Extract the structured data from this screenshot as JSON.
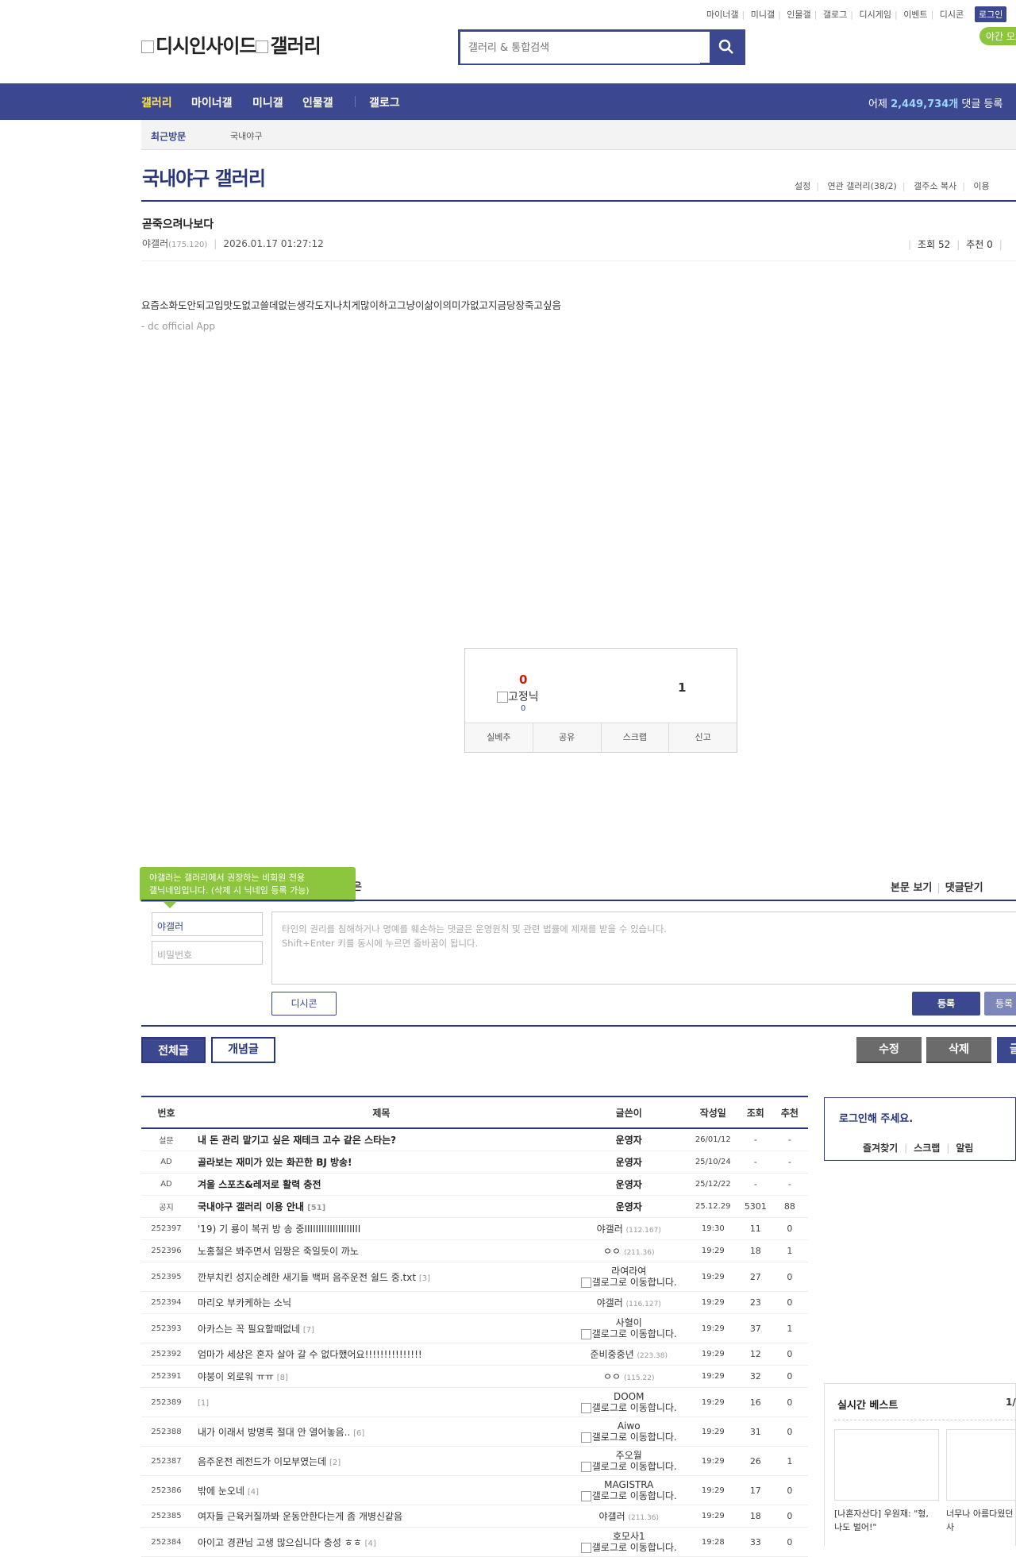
{
  "header": {
    "top_links": [
      "마이너갤",
      "미니갤",
      "인물갤",
      "갤로그",
      "디시게임",
      "이벤트",
      "디시콘"
    ],
    "login": "로그인",
    "night_mode": "야간 모드",
    "logo_text": "디시인사이드",
    "logo_sub": "갤러리",
    "search_placeholder": "갤러리 & 통합검색"
  },
  "nav": {
    "items": [
      "갤러리",
      "마이너갤",
      "미니갤",
      "인물갤",
      "갤로그"
    ],
    "stat_prefix": "어제",
    "stat_value": "2,449,734개",
    "stat_suffix": "댓글 등록"
  },
  "recent": {
    "label": "최근방문",
    "item": "국내야구"
  },
  "gallery": {
    "title": "국내야구 갤러리",
    "tools": [
      "설정",
      "연관 갤러리(38/2)",
      "갤주소 복사",
      "이용"
    ]
  },
  "post": {
    "title": "곧죽으려나보다",
    "author": "야갤러",
    "ip": "(175.120)",
    "date": "2026.01.17 01:27:12",
    "views": "조회 52",
    "recommend": "추천 0",
    "body": "요즘소화도안되고입맛도없고쓸데없는생각도지나치게많이하고그냥이삶이의미가없고지금당장죽고싶음",
    "footer": "- dc official App"
  },
  "vote": {
    "up": "0",
    "fixed_label": "고정닉",
    "fixed_count": "0",
    "down": "1",
    "buttons": [
      "실베추",
      "공유",
      "스크랩",
      "신고"
    ]
  },
  "comment": {
    "tooltip_line1": "야갤러는 갤러리에서 권장하는 비회원 전용",
    "tooltip_line2": "갤닉네임입니다. (삭제 시 닉네임 등록 가능)",
    "title_tail": "은",
    "view_links": [
      "본문 보기",
      "댓글닫기"
    ],
    "nick": "야갤러",
    "password_placeholder": "비밀번호",
    "placeholder_line1": "타인의 권리를 침해하거나 명예를 훼손하는 댓글은 운영원칙 및 관련 법률에 제재를 받을 수 있습니다.",
    "placeholder_line2": "Shift+Enter 키를 동시에 누르면 줄바꿈이 됩니다.",
    "dccon": "디시콘",
    "submit": "등록",
    "submit2": "등록"
  },
  "list_buttons": {
    "all": "전체글",
    "concept": "개념글",
    "edit": "수정",
    "delete": "삭제",
    "write": "글"
  },
  "table": {
    "headers": [
      "번호",
      "제목",
      "글쓴이",
      "작성일",
      "조회",
      "추천"
    ],
    "rows": [
      {
        "num": "설문",
        "title": "내 돈 관리 맡기고 싶은 재테크 고수 같은 스타는?",
        "rc": "",
        "writer": "운영자",
        "ip": "",
        "date": "26/01/12",
        "views": "-",
        "rec": "-",
        "notice": true
      },
      {
        "num": "AD",
        "title": "골라보는 재미가 있는 화끈한 BJ 방송!",
        "rc": "",
        "writer": "운영자",
        "ip": "",
        "date": "25/10/24",
        "views": "-",
        "rec": "-",
        "notice": true
      },
      {
        "num": "AD",
        "title": "겨울 스포츠&레저로 활력 충전",
        "rc": "",
        "writer": "운영자",
        "ip": "",
        "date": "25/12/22",
        "views": "-",
        "rec": "-",
        "notice": true
      },
      {
        "num": "공지",
        "title": "국내야구 갤러리 이용 안내",
        "rc": "[51]",
        "writer": "운영자",
        "ip": "",
        "date": "25.12.29",
        "views": "5301",
        "rec": "88",
        "notice": true
      },
      {
        "num": "252397",
        "title": "'19) 기 룡이 복귀 방 송 중IIIIIIIIIIIIIIIIIIII",
        "rc": "",
        "writer": "야갤러",
        "ip": "(112.167)",
        "date": "19:30",
        "views": "11",
        "rec": "0"
      },
      {
        "num": "252396",
        "title": "노홍철은 봐주면서 임짱은 죽일듯이 까노",
        "rc": "",
        "writer": "ㅇㅇ",
        "ip": "(211.36)",
        "date": "19:29",
        "views": "18",
        "rec": "1"
      },
      {
        "num": "252395",
        "title": "깐부치킨 성지순례한 새기들 백퍼 음주운전 쉴드 중.txt",
        "rc": "[3]",
        "writer": "라여라여",
        "gallog": "갤로그로 이동합니다.",
        "date": "19:29",
        "views": "27",
        "rec": "0"
      },
      {
        "num": "252394",
        "title": "마리오 부카케하는 소닉",
        "rc": "",
        "writer": "야갤러",
        "ip": "(116.127)",
        "date": "19:29",
        "views": "23",
        "rec": "0"
      },
      {
        "num": "252393",
        "title": "아카스는 꼭 필요할때없네",
        "rc": "[7]",
        "writer": "사혈이",
        "gallog": "갤로그로 이동합니다.",
        "date": "19:29",
        "views": "37",
        "rec": "1"
      },
      {
        "num": "252392",
        "title": "엄마가 세상은 혼자 살아 갈 수 없다했어요!!!!!!!!!!!!!!!",
        "rc": "",
        "writer": "준비중중년",
        "ip": "(223.38)",
        "date": "19:29",
        "views": "12",
        "rec": "0"
      },
      {
        "num": "252391",
        "title": "야붕이 외로워 ㅠㅠ",
        "rc": "[8]",
        "writer": "ㅇㅇ",
        "ip": "(115.22)",
        "date": "19:29",
        "views": "32",
        "rec": "0"
      },
      {
        "num": "252389",
        "title": "",
        "rc": "[1]",
        "writer": "DOOM",
        "gallog": "갤로그로 이동합니다.",
        "date": "19:29",
        "views": "16",
        "rec": "0"
      },
      {
        "num": "252388",
        "title": "내가 이래서 방명록 절대 안 열어놓음..",
        "rc": "[6]",
        "writer": "Aiwo",
        "gallog": "갤로그로 이동합니다.",
        "date": "19:29",
        "views": "31",
        "rec": "0"
      },
      {
        "num": "252387",
        "title": "음주운전 레전드가 이모부였는데",
        "rc": "[2]",
        "writer": "주오월",
        "gallog": "갤로그로 이동합니다.",
        "date": "19:29",
        "views": "26",
        "rec": "1"
      },
      {
        "num": "252386",
        "title": "밖에 눈오네",
        "rc": "[4]",
        "writer": "MAGISTRA",
        "gallog": "갤로그로 이동합니다.",
        "date": "19:29",
        "views": "17",
        "rec": "0"
      },
      {
        "num": "252385",
        "title": "여자들 근육커질까봐 운동안한다는게 좀 개병신같음",
        "rc": "",
        "writer": "야갤러",
        "ip": "(211.36)",
        "date": "19:29",
        "views": "18",
        "rec": "0"
      },
      {
        "num": "252384",
        "title": "아이고 경관님 고생 많으십니다 충성 ㅎㅎ",
        "rc": "[4]",
        "writer": "호모사1",
        "gallog": "갤로그로 이동합니다.",
        "date": "19:28",
        "views": "33",
        "rec": "0"
      }
    ]
  },
  "sidebar": {
    "login_title": "로그인해 주세요.",
    "login_links": [
      "즐겨찾기",
      "스크랩",
      "알림"
    ],
    "best_title": "실시간 베스트",
    "best_page": "1/",
    "best_items": [
      {
        "caption": "[나혼자산다] 우원재: \"형, 나도 벌어!\""
      },
      {
        "caption": "너무나 아름다웠던 하 변천사"
      }
    ]
  },
  "colors": {
    "primary": "#3b4890",
    "dark": "#29367c",
    "accent": "#ffe44b",
    "green": "#8cc63f",
    "red": "#d31900"
  }
}
